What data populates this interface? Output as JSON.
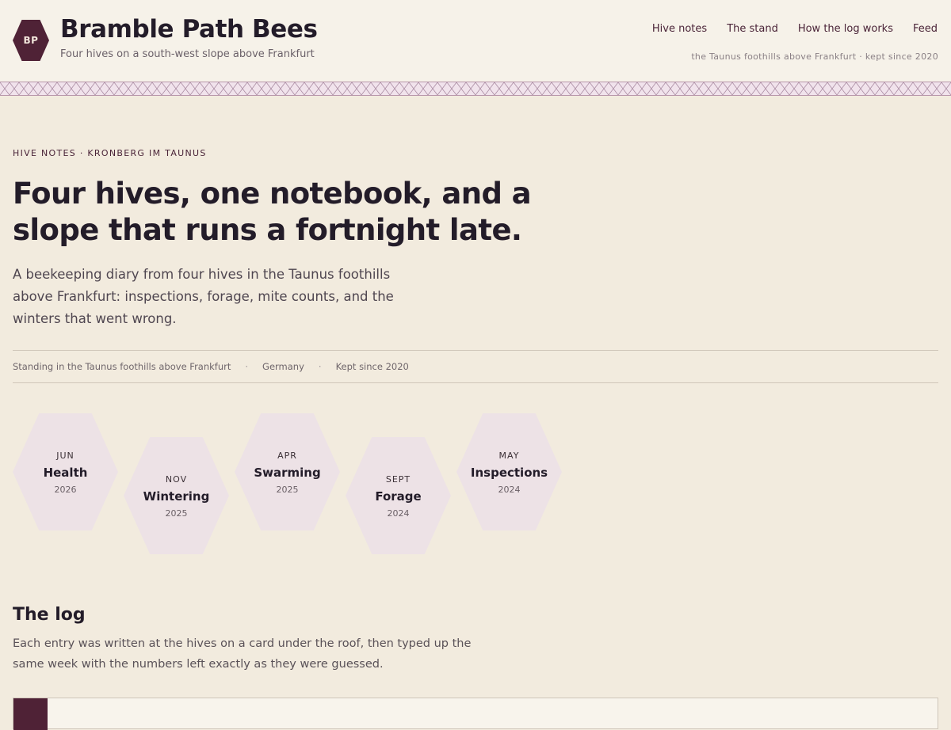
{
  "header": {
    "logo_text": "BP",
    "site_title": "Bramble Path Bees",
    "tagline": "Four hives on a south-west slope above Frankfurt",
    "nav": [
      {
        "label": "Hive notes"
      },
      {
        "label": "The stand"
      },
      {
        "label": "How the log works"
      },
      {
        "label": "Feed"
      }
    ],
    "meta": "the Taunus foothills above Frankfurt · kept since 2020"
  },
  "hero": {
    "eyebrow": "HIVE NOTES · KRONBERG IM TAUNUS",
    "headline": "Four hives, one notebook, and a slope that runs a fortnight late.",
    "lede": "A beekeeping diary from four hives in the Taunus foothills above Frankfurt: inspections, forage, mite counts, and the winters that went wrong.",
    "meta": {
      "location": "Standing in the Taunus foothills above Frankfurt",
      "country": "Germany",
      "since": "Kept since 2020",
      "separator": "·"
    }
  },
  "categories": [
    {
      "month": "JUN",
      "topic": "Health",
      "year": "2026"
    },
    {
      "month": "NOV",
      "topic": "Wintering",
      "year": "2025"
    },
    {
      "month": "APR",
      "topic": "Swarming",
      "year": "2025"
    },
    {
      "month": "SEPT",
      "topic": "Forage",
      "year": "2024"
    },
    {
      "month": "MAY",
      "topic": "Inspections",
      "year": "2024"
    }
  ],
  "log": {
    "title": "The log",
    "intro": "Each entry was written at the hives on a card under the roof, then typed up the same week with the numbers left exactly as they were guessed."
  },
  "colors": {
    "accent": "#4f2236",
    "background": "#f2ebde",
    "hex_fill": "#ede2e6"
  }
}
